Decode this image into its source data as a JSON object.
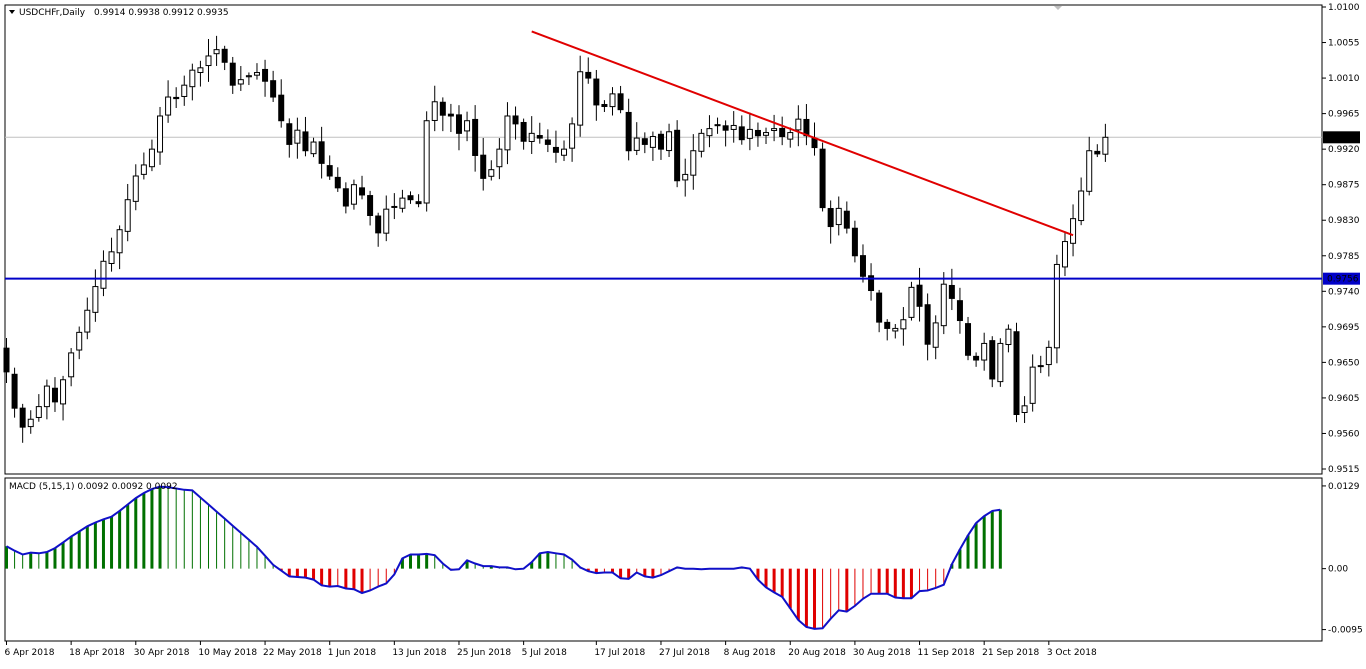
{
  "header": {
    "symbol_label": "USDCHFr,Daily",
    "ohlc_label": "0.9914 0.9938 0.9912 0.9935"
  },
  "indicator": {
    "label": "MACD (5,15,1) 0.0092 0.0092 0.0092"
  },
  "colors": {
    "frame": "#000000",
    "bull_body": "#ffffff",
    "bear_body": "#000000",
    "trendline": "#e00000",
    "support_line": "#0000c8",
    "bid_line": "#c0c0c0",
    "macd_line": "#1010c8",
    "hist_positive": "#007000",
    "hist_negative": "#e00000"
  },
  "chart_data": [
    {
      "type": "candlestick",
      "title": "USDCHFr,Daily",
      "ylim": [
        0.9515,
        1.01
      ],
      "y_ticks": [
        "1.0100",
        "1.0055",
        "1.0010",
        "0.9965",
        "0.9920",
        "0.9875",
        "0.9830",
        "0.9785",
        "0.9740",
        "0.9695",
        "0.9650",
        "0.9605",
        "0.9560",
        "0.9515"
      ],
      "x_ticks": [
        {
          "index": 0,
          "label": "6 Apr 2018"
        },
        {
          "index": 8,
          "label": "18 Apr 2018"
        },
        {
          "index": 16,
          "label": "30 Apr 2018"
        },
        {
          "index": 24,
          "label": "10 May 2018"
        },
        {
          "index": 32,
          "label": "22 May 2018"
        },
        {
          "index": 40,
          "label": "1 Jun 2018"
        },
        {
          "index": 48,
          "label": "13 Jun 2018"
        },
        {
          "index": 56,
          "label": "25 Jun 2018"
        },
        {
          "index": 64,
          "label": "5 Jul 2018"
        },
        {
          "index": 73,
          "label": "17 Jul 2018"
        },
        {
          "index": 81,
          "label": "27 Jul 2018"
        },
        {
          "index": 89,
          "label": "8 Aug 2018"
        },
        {
          "index": 97,
          "label": "20 Aug 2018"
        },
        {
          "index": 105,
          "label": "30 Aug 2018"
        },
        {
          "index": 113,
          "label": "11 Sep 2018"
        },
        {
          "index": 121,
          "label": "21 Sep 2018"
        },
        {
          "index": 129,
          "label": "3 Oct 2018"
        }
      ],
      "close": [
        0.9638,
        0.9592,
        0.9568,
        0.9578,
        0.9594,
        0.962,
        0.96,
        0.9628,
        0.9662,
        0.9688,
        0.9716,
        0.9746,
        0.9778,
        0.979,
        0.9818,
        0.9856,
        0.9886,
        0.99,
        0.992,
        0.9962,
        0.9986,
        0.9984,
        1.0001,
        1.002,
        1.0023,
        1.0038,
        1.0046,
        1.003,
        1.0001,
        1.0008,
        1.0013,
        1.0017,
        1.0006,
        0.9986,
        0.9956,
        0.9926,
        0.9944,
        0.9918,
        0.9929,
        0.9902,
        0.9886,
        0.9871,
        0.9848,
        0.9875,
        0.9862,
        0.9836,
        0.9814,
        0.9844,
        0.9847,
        0.9858,
        0.9856,
        0.9851,
        0.9956,
        0.998,
        0.9963,
        0.9962,
        0.994,
        0.9956,
        0.9912,
        0.9883,
        0.9894,
        0.992,
        0.9962,
        0.9952,
        0.993,
        0.994,
        0.9934,
        0.9926,
        0.9916,
        0.992,
        0.9952,
        1.0018,
        1.001,
        0.9976,
        0.9974,
        0.999,
        0.997,
        0.9918,
        0.9934,
        0.9926,
        0.9936,
        0.992,
        0.9942,
        0.988,
        0.9888,
        0.9918,
        0.994,
        0.9946,
        0.9951,
        0.9944,
        0.995,
        0.9932,
        0.9945,
        0.9937,
        0.9941,
        0.9946,
        0.9936,
        0.9941,
        0.9958,
        0.9937,
        0.9922,
        0.9846,
        0.9822,
        0.9845,
        0.982,
        0.9785,
        0.9759,
        0.9741,
        0.9701,
        0.9693,
        0.9693,
        0.9704,
        0.9745,
        0.9721,
        0.9673,
        0.97,
        0.9749,
        0.9731,
        0.9703,
        0.9659,
        0.9653,
        0.9674,
        0.9629,
        0.9674,
        0.9692,
        0.9584,
        0.9595,
        0.9644,
        0.9645,
        0.9669,
        0.9774,
        0.9803,
        0.9832,
        0.9867,
        0.9918,
        0.9914,
        0.9935
      ],
      "macd": [
        0.0035,
        0.0028,
        0.0022,
        0.0025,
        0.0024,
        0.0026,
        0.0032,
        0.0041,
        0.005,
        0.0058,
        0.0066,
        0.0072,
        0.0077,
        0.0081,
        0.009,
        0.01,
        0.011,
        0.0118,
        0.0124,
        0.0128,
        0.0127,
        0.0125,
        0.0123,
        0.0122,
        0.0111,
        0.01,
        0.0089,
        0.0078,
        0.0067,
        0.0056,
        0.0045,
        0.0034,
        0.002,
        0.0006,
        -0.0003,
        -0.0012,
        -0.0013,
        -0.0014,
        -0.0017,
        -0.0026,
        -0.0028,
        -0.0027,
        -0.0031,
        -0.0032,
        -0.0038,
        -0.0034,
        -0.0028,
        -0.0023,
        -0.0009,
        0.0016,
        0.0022,
        0.0022,
        0.0023,
        0.0021,
        0.0008,
        -0.0002,
        -0.0001,
        0.0013,
        0.0008,
        0.0004,
        0.0004,
        0.0002,
        0.0002,
        -0.0001,
        0.0,
        0.001,
        0.0024,
        0.0026,
        0.0024,
        0.0022,
        0.0014,
        0.0002,
        -0.0004,
        -0.0007,
        -0.0006,
        -0.0006,
        -0.0015,
        -0.0016,
        -0.0006,
        -0.0012,
        -0.0014,
        -0.001,
        -0.0004,
        0.0002,
        0.0,
        0.0,
        -0.0001,
        0.0,
        0.0,
        0.0,
        0.0,
        0.0002,
        0.0,
        -0.0017,
        -0.0029,
        -0.0037,
        -0.0044,
        -0.0062,
        -0.008,
        -0.0091,
        -0.0094,
        -0.0093,
        -0.0078,
        -0.0065,
        -0.0067,
        -0.0058,
        -0.0047,
        -0.0039,
        -0.0039,
        -0.0039,
        -0.0045,
        -0.0046,
        -0.0046,
        -0.0035,
        -0.0034,
        -0.003,
        -0.0025,
        0.0007,
        0.003,
        0.0052,
        0.0071,
        0.0082,
        0.009,
        0.0092
      ],
      "macd_ylim": [
        -0.0105,
        0.0132
      ],
      "macd_ticks": [
        "0.0129",
        "0.00",
        "-0.0095"
      ],
      "trendline": {
        "from": {
          "index": 65,
          "price": 1.0069
        },
        "to": {
          "index": 132,
          "price": 0.9811
        }
      },
      "support_level": 0.9756,
      "support_label": "0.9756",
      "current_price": 0.9935,
      "current_label": "0.9935",
      "grid": false
    }
  ]
}
